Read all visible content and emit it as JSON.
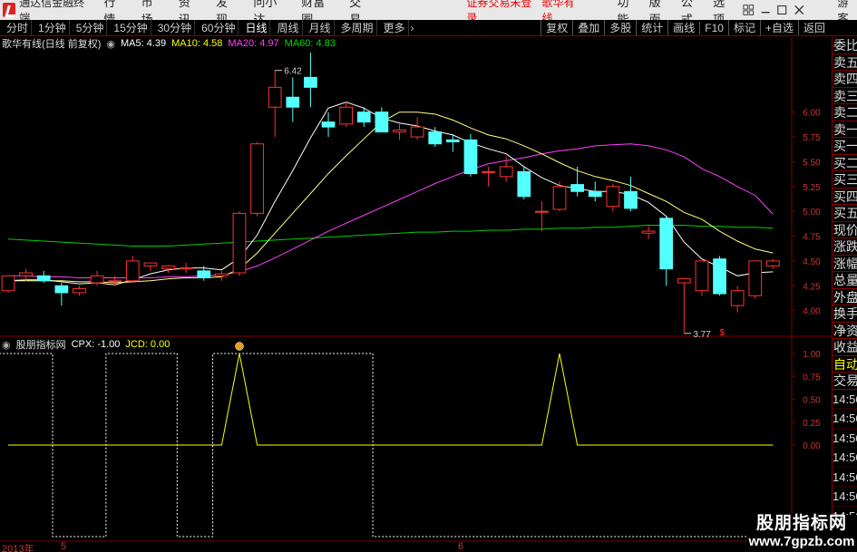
{
  "titlebar": {
    "app_name": "通达信金融终端",
    "menu": [
      "行情",
      "市场",
      "资讯",
      "发现",
      "问小达",
      "财富圈",
      "交易"
    ],
    "notice": "证券交易未登录",
    "brand": "歌华有线",
    "right_menu": [
      "功能",
      "版面",
      "公式",
      "选项"
    ],
    "guest": "游客"
  },
  "toolbar": {
    "periods": [
      "分时",
      "1分钟",
      "5分钟",
      "15分钟",
      "30分钟",
      "60分钟",
      "日线",
      "周线",
      "月线",
      "多周期",
      "更多"
    ],
    "active_period": "日线",
    "right_tools": [
      "复权",
      "叠加",
      "多股",
      "统计",
      "画线",
      "F10",
      "标记",
      "+自选",
      "返回"
    ]
  },
  "main_info": {
    "stock": "歌华有线(日线 前复权)",
    "ma5": "MA5: 4.39",
    "ma10": "MA10: 4.58",
    "ma20": "MA20: 4.97",
    "ma60": "MA60: 4.83"
  },
  "indicator_info": {
    "name": "股朋指标网",
    "cpx": "CPX: -1.00",
    "jcd": "JCD: 0.00"
  },
  "price_axis": [
    "6.00",
    "5.75",
    "5.50",
    "5.25",
    "5.00",
    "4.75",
    "4.50",
    "4.25",
    "4.00"
  ],
  "indicator_axis": [
    "1.00",
    "0.75",
    "0.50",
    "0.25",
    "0.00"
  ],
  "annotations": {
    "high": "6.42",
    "low": "3.77",
    "dollar": "$"
  },
  "date_axis": {
    "year": "2013年",
    "m5": "5",
    "m6": "6"
  },
  "right_panel": {
    "items": [
      "委比",
      "卖五",
      "卖四",
      "卖三",
      "卖二",
      "卖一",
      "买一",
      "买二",
      "买三",
      "买四",
      "买五",
      "现价",
      "涨跌",
      "涨幅",
      "总量",
      "外盘",
      "换手",
      "净资",
      "收益"
    ],
    "trade_items": [
      "自动",
      "交易"
    ],
    "times": [
      "14:56",
      "14:56",
      "14:56",
      "14:56",
      "14:56",
      "14:56",
      "14:56",
      "14:56",
      "14:56"
    ]
  },
  "watermark": {
    "line1": "股朋指标网",
    "line2": "www.7gpzb.com"
  },
  "colors": {
    "up": "#ff3232",
    "down": "#54ffff",
    "ma5": "#ffffff",
    "ma10": "#ffff80",
    "ma20": "#ff40ff",
    "ma60": "#00d000",
    "indicator_cpx": "#ffffff",
    "indicator_jcd": "#ffff00",
    "frame": "#800000"
  },
  "chart_data": {
    "type": "candlestick",
    "candles": [
      {
        "o": 4.2,
        "h": 4.35,
        "l": 4.18,
        "c": 4.35
      },
      {
        "o": 4.35,
        "h": 4.42,
        "l": 4.3,
        "c": 4.38
      },
      {
        "o": 4.35,
        "h": 4.4,
        "l": 4.28,
        "c": 4.3
      },
      {
        "o": 4.25,
        "h": 4.28,
        "l": 4.05,
        "c": 4.18
      },
      {
        "o": 4.18,
        "h": 4.25,
        "l": 4.15,
        "c": 4.22
      },
      {
        "o": 4.28,
        "h": 4.4,
        "l": 4.25,
        "c": 4.35
      },
      {
        "o": 4.3,
        "h": 4.35,
        "l": 4.25,
        "c": 4.3
      },
      {
        "o": 4.3,
        "h": 4.55,
        "l": 4.28,
        "c": 4.5
      },
      {
        "o": 4.45,
        "h": 4.48,
        "l": 4.4,
        "c": 4.48
      },
      {
        "o": 4.42,
        "h": 4.46,
        "l": 4.38,
        "c": 4.45
      },
      {
        "o": 4.42,
        "h": 4.48,
        "l": 4.38,
        "c": 4.43
      },
      {
        "o": 4.4,
        "h": 4.45,
        "l": 4.3,
        "c": 4.33
      },
      {
        "o": 4.35,
        "h": 4.4,
        "l": 4.3,
        "c": 4.37
      },
      {
        "o": 4.38,
        "h": 5.0,
        "l": 4.35,
        "c": 4.98
      },
      {
        "o": 4.98,
        "h": 5.7,
        "l": 4.95,
        "c": 5.68
      },
      {
        "o": 6.05,
        "h": 6.42,
        "l": 5.75,
        "c": 6.25
      },
      {
        "o": 6.15,
        "h": 6.35,
        "l": 5.9,
        "c": 6.05
      },
      {
        "o": 6.35,
        "h": 6.6,
        "l": 6.05,
        "c": 6.25
      },
      {
        "o": 5.9,
        "h": 6.0,
        "l": 5.75,
        "c": 5.85
      },
      {
        "o": 5.88,
        "h": 6.1,
        "l": 5.85,
        "c": 6.05
      },
      {
        "o": 6.0,
        "h": 6.05,
        "l": 5.85,
        "c": 5.9
      },
      {
        "o": 6.0,
        "h": 6.05,
        "l": 5.8,
        "c": 5.8
      },
      {
        "o": 5.8,
        "h": 5.88,
        "l": 5.72,
        "c": 5.82
      },
      {
        "o": 5.75,
        "h": 5.95,
        "l": 5.72,
        "c": 5.85
      },
      {
        "o": 5.8,
        "h": 5.85,
        "l": 5.65,
        "c": 5.68
      },
      {
        "o": 5.72,
        "h": 5.78,
        "l": 5.6,
        "c": 5.7
      },
      {
        "o": 5.72,
        "h": 5.78,
        "l": 5.35,
        "c": 5.38
      },
      {
        "o": 5.4,
        "h": 5.45,
        "l": 5.25,
        "c": 5.4
      },
      {
        "o": 5.35,
        "h": 5.55,
        "l": 5.3,
        "c": 5.45
      },
      {
        "o": 5.4,
        "h": 5.45,
        "l": 5.12,
        "c": 5.15
      },
      {
        "o": 5.0,
        "h": 5.1,
        "l": 4.8,
        "c": 5.0
      },
      {
        "o": 5.02,
        "h": 5.3,
        "l": 5.0,
        "c": 5.25
      },
      {
        "o": 5.27,
        "h": 5.45,
        "l": 5.15,
        "c": 5.2
      },
      {
        "o": 5.2,
        "h": 5.3,
        "l": 5.1,
        "c": 5.15
      },
      {
        "o": 5.05,
        "h": 5.28,
        "l": 5.0,
        "c": 5.25
      },
      {
        "o": 5.2,
        "h": 5.35,
        "l": 5.0,
        "c": 5.03
      },
      {
        "o": 4.78,
        "h": 4.85,
        "l": 4.72,
        "c": 4.8
      },
      {
        "o": 4.93,
        "h": 4.95,
        "l": 4.25,
        "c": 4.42
      },
      {
        "o": 4.28,
        "h": 4.32,
        "l": 3.77,
        "c": 4.32
      },
      {
        "o": 4.2,
        "h": 4.5,
        "l": 4.15,
        "c": 4.5
      },
      {
        "o": 4.52,
        "h": 4.55,
        "l": 4.15,
        "c": 4.17
      },
      {
        "o": 4.05,
        "h": 4.25,
        "l": 3.98,
        "c": 4.2
      },
      {
        "o": 4.15,
        "h": 4.5,
        "l": 4.12,
        "c": 4.5
      },
      {
        "o": 4.45,
        "h": 4.52,
        "l": 4.42,
        "c": 4.5
      }
    ],
    "ma5": [
      4.3,
      4.31,
      4.31,
      4.29,
      4.27,
      4.28,
      4.26,
      4.31,
      4.37,
      4.41,
      4.43,
      4.43,
      4.41,
      4.53,
      4.76,
      5.1,
      5.41,
      5.74,
      6.04,
      6.1,
      6.04,
      5.94,
      5.89,
      5.86,
      5.81,
      5.77,
      5.69,
      5.63,
      5.58,
      5.45,
      5.34,
      5.26,
      5.23,
      5.2,
      5.2,
      5.17,
      5.09,
      4.95,
      4.69,
      4.52,
      4.44,
      4.35,
      4.38,
      4.39
    ],
    "ma10": [
      4.3,
      4.3,
      4.3,
      4.3,
      4.29,
      4.29,
      4.28,
      4.29,
      4.3,
      4.32,
      4.33,
      4.33,
      4.34,
      4.42,
      4.58,
      4.78,
      4.98,
      5.18,
      5.38,
      5.56,
      5.73,
      5.9,
      6.0,
      6.0,
      5.98,
      5.92,
      5.84,
      5.77,
      5.73,
      5.66,
      5.58,
      5.49,
      5.41,
      5.35,
      5.31,
      5.26,
      5.18,
      5.1,
      4.99,
      4.92,
      4.8,
      4.7,
      4.62,
      4.58
    ],
    "ma20": [
      4.35,
      4.35,
      4.34,
      4.34,
      4.33,
      4.33,
      4.33,
      4.33,
      4.33,
      4.34,
      4.34,
      4.35,
      4.36,
      4.39,
      4.45,
      4.53,
      4.62,
      4.71,
      4.8,
      4.88,
      4.96,
      5.04,
      5.12,
      5.2,
      5.28,
      5.35,
      5.42,
      5.48,
      5.51,
      5.54,
      5.58,
      5.61,
      5.63,
      5.66,
      5.67,
      5.68,
      5.66,
      5.62,
      5.55,
      5.43,
      5.35,
      5.25,
      5.16,
      4.97
    ],
    "ma60": [
      4.72,
      4.71,
      4.7,
      4.69,
      4.68,
      4.67,
      4.66,
      4.65,
      4.65,
      4.65,
      4.66,
      4.67,
      4.68,
      4.69,
      4.7,
      4.71,
      4.72,
      4.73,
      4.74,
      4.75,
      4.76,
      4.77,
      4.78,
      4.79,
      4.79,
      4.8,
      4.8,
      4.81,
      4.81,
      4.82,
      4.82,
      4.83,
      4.83,
      4.84,
      4.84,
      4.85,
      4.86,
      4.86,
      4.86,
      4.85,
      4.85,
      4.84,
      4.84,
      4.83
    ],
    "cpx": [
      1,
      1,
      1,
      -1,
      -1,
      -1,
      1,
      1,
      1,
      1,
      -1,
      -1,
      1,
      1,
      1,
      1,
      1,
      1,
      1,
      1,
      1,
      -1,
      -1,
      -1,
      -1,
      -1,
      -1,
      -1,
      -1,
      -1,
      -1,
      -1,
      -1,
      -1,
      -1,
      -1,
      -1,
      -1,
      -1,
      -1,
      -1,
      -1,
      -1,
      -1
    ],
    "jcd": [
      0,
      0,
      0,
      0,
      0,
      0,
      0,
      0,
      0,
      0,
      0,
      0,
      0,
      1,
      0,
      0,
      0,
      0,
      0,
      0,
      0,
      0,
      0,
      0,
      0,
      0,
      0,
      0,
      0,
      0,
      0,
      1,
      0,
      0,
      0,
      0,
      0,
      0,
      0,
      0,
      0,
      0,
      0,
      0
    ],
    "price_range": [
      3.75,
      6.6
    ],
    "indicator_range": [
      -1.0,
      1.0
    ]
  }
}
